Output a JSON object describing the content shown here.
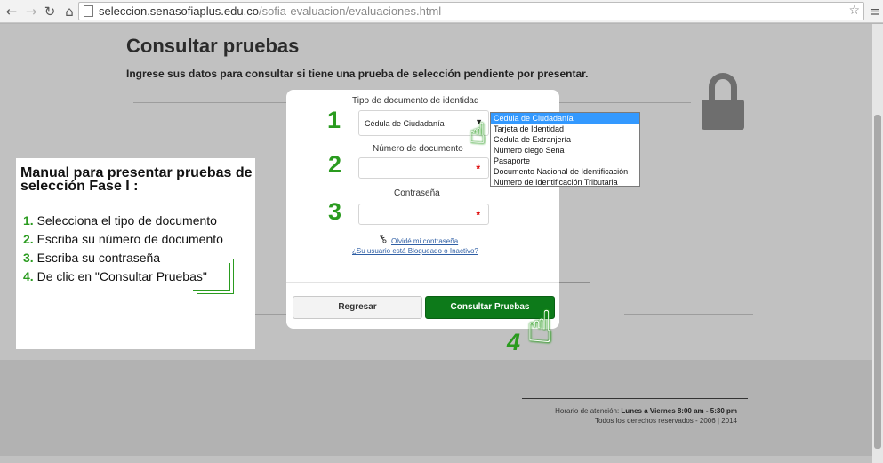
{
  "browser": {
    "url_host": "seleccion.senasofiaplus.edu.co",
    "url_path": "/sofia-evaluacion/evaluaciones.html",
    "icons": [
      "back-arrow-icon",
      "forward-arrow-icon",
      "reload-icon",
      "home-icon",
      "page-icon",
      "star-icon",
      "menu-icon"
    ]
  },
  "page": {
    "title": "Consultar pruebas",
    "subtitle": "Ingrese sus datos para consultar si tiene una prueba de selección pendiente por presentar.",
    "footer_hours_label": "Horario de atención:",
    "footer_hours_value": "Lunes a Viernes 8:00 am - 5:30 pm",
    "footer_rights": "Todos los derechos reservados - 2006 | 2014"
  },
  "form": {
    "doc_type_label": "Tipo de documento de identidad",
    "doc_type_value": "Cédula de Ciudadanía",
    "doc_type_options": [
      "Cédula de Ciudadanía",
      "Tarjeta de Identidad",
      "Cédula de Extranjería",
      "Número ciego Sena",
      "Pasaporte",
      "Documento Nacional de Identificación",
      "Número de Identificación Tributaria"
    ],
    "doc_number_label": "Número de documento",
    "password_label": "Contraseña",
    "required_mark": "*",
    "forgot_password": "Olvidé mi contraseña",
    "blocked_user": "¿Su usuario está Bloqueado o Inactivo?",
    "back_button": "Regresar",
    "submit_button": "Consultar Pruebas"
  },
  "steps": {
    "s1": "1",
    "s2": "2",
    "s3": "3",
    "s4": "4"
  },
  "manual": {
    "title": "Manual para presentar pruebas de selección Fase I :",
    "items": [
      {
        "num": "1.",
        "text": "Selecciona el tipo de documento"
      },
      {
        "num": "2.",
        "text": "Escriba su número de documento"
      },
      {
        "num": "3.",
        "text": "Escriba su contraseña"
      },
      {
        "num": "4.",
        "text": "De clic en \"Consultar Pruebas\""
      }
    ]
  },
  "colors": {
    "accent_green": "#2a9b1f",
    "button_green": "#0d7a1a",
    "selection_blue": "#3399ff"
  }
}
